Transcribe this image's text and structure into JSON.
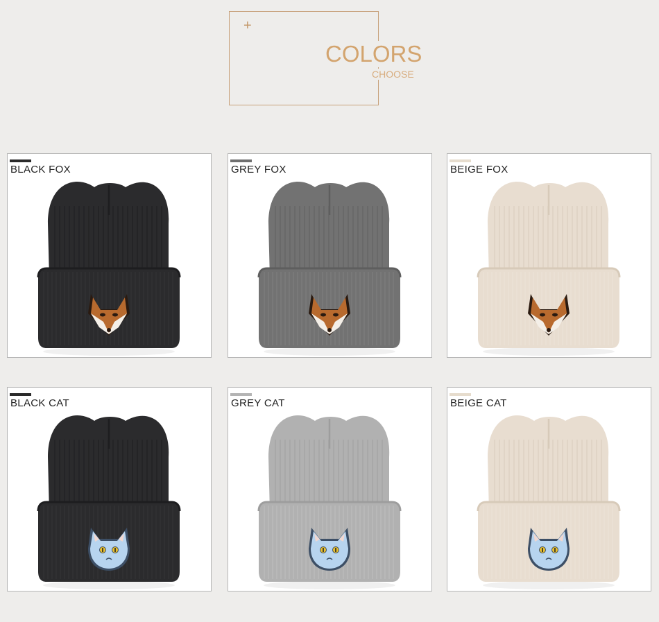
{
  "header": {
    "plus": "+",
    "title": "COLORS",
    "subtitle": "CHOOSE"
  },
  "products": [
    {
      "label": "BLACK FOX",
      "bar_color": "#2a2a2a",
      "hat_color": "#2b2b2d",
      "hat_shade": "#1d1d1f",
      "rib_color": "#3a3a3c",
      "patch": "fox",
      "patch_icon": "fox-face-icon"
    },
    {
      "label": "GREY FOX",
      "bar_color": "#6f6f6f",
      "hat_color": "#727272",
      "hat_shade": "#5e5e5e",
      "rib_color": "#858585",
      "patch": "fox",
      "patch_icon": "fox-face-icon"
    },
    {
      "label": "BEIGE FOX",
      "bar_color": "#e6dccd",
      "hat_color": "#e8ddd0",
      "hat_shade": "#d7cab9",
      "rib_color": "#efe6db",
      "patch": "fox",
      "patch_icon": "fox-face-icon"
    },
    {
      "label": "BLACK CAT",
      "bar_color": "#2a2a2a",
      "hat_color": "#2b2b2d",
      "hat_shade": "#1d1d1f",
      "rib_color": "#3a3a3c",
      "patch": "cat",
      "patch_icon": "cat-face-icon"
    },
    {
      "label": "GREY CAT",
      "bar_color": "#b4b4b4",
      "hat_color": "#b1b1b1",
      "hat_shade": "#9d9d9d",
      "rib_color": "#c2c2c2",
      "patch": "cat",
      "patch_icon": "cat-face-icon"
    },
    {
      "label": "BEIGE CAT",
      "bar_color": "#e6dccd",
      "hat_color": "#e8ddd0",
      "hat_shade": "#d7cab9",
      "rib_color": "#efe6db",
      "patch": "cat",
      "patch_icon": "cat-face-icon"
    }
  ]
}
